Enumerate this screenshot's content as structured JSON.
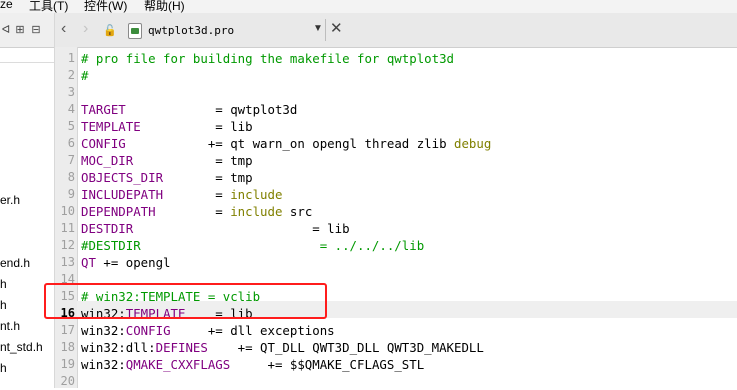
{
  "menubar": {
    "items": [
      "ze",
      "工具(T)",
      "控件(W)",
      "帮助(H)"
    ]
  },
  "left_panel": {
    "files": [
      "er.h",
      "end.h",
      "h",
      "h",
      "nt.h",
      "nt_std.h",
      "h"
    ]
  },
  "tab": {
    "title": "qwtplot3d.pro",
    "back_icon": "‹",
    "forward_icon": "›",
    "lock_icon": "🔓",
    "dropdown_icon": "▼",
    "close_icon": "✕"
  },
  "editor": {
    "current_line": 16,
    "highlighted_lines": [
      15,
      16
    ],
    "lines": [
      {
        "n": 1,
        "parts": [
          {
            "t": "# pro file for building the makefile for qwtplot3d",
            "c": "comment"
          }
        ]
      },
      {
        "n": 2,
        "parts": [
          {
            "t": "#",
            "c": "comment"
          }
        ]
      },
      {
        "n": 3,
        "parts": []
      },
      {
        "n": 4,
        "parts": [
          {
            "t": "TARGET",
            "c": "var"
          },
          {
            "t": "            = qwtplot3d",
            "c": "plain"
          }
        ]
      },
      {
        "n": 5,
        "parts": [
          {
            "t": "TEMPLATE",
            "c": "var"
          },
          {
            "t": "          = lib",
            "c": "plain"
          }
        ]
      },
      {
        "n": 6,
        "parts": [
          {
            "t": "CONFIG",
            "c": "var"
          },
          {
            "t": "           += qt warn_on opengl thread zlib ",
            "c": "plain"
          },
          {
            "t": "debug",
            "c": "keyword"
          }
        ]
      },
      {
        "n": 7,
        "parts": [
          {
            "t": "MOC_DIR",
            "c": "var"
          },
          {
            "t": "           = tmp",
            "c": "plain"
          }
        ]
      },
      {
        "n": 8,
        "parts": [
          {
            "t": "OBJECTS_DIR",
            "c": "var"
          },
          {
            "t": "       = tmp",
            "c": "plain"
          }
        ]
      },
      {
        "n": 9,
        "parts": [
          {
            "t": "INCLUDEPATH",
            "c": "var"
          },
          {
            "t": "       = ",
            "c": "plain"
          },
          {
            "t": "include",
            "c": "keyword"
          }
        ]
      },
      {
        "n": 10,
        "parts": [
          {
            "t": "DEPENDPATH",
            "c": "var"
          },
          {
            "t": "        = ",
            "c": "plain"
          },
          {
            "t": "include",
            "c": "keyword"
          },
          {
            "t": " src",
            "c": "plain"
          }
        ]
      },
      {
        "n": 11,
        "parts": [
          {
            "t": "DESTDIR",
            "c": "var"
          },
          {
            "t": "                        = lib",
            "c": "plain"
          }
        ]
      },
      {
        "n": 12,
        "parts": [
          {
            "t": "#DESTDIR                        = ../../../lib",
            "c": "comment"
          }
        ]
      },
      {
        "n": 13,
        "parts": [
          {
            "t": "QT",
            "c": "var"
          },
          {
            "t": " += opengl",
            "c": "plain"
          }
        ]
      },
      {
        "n": 14,
        "parts": []
      },
      {
        "n": 15,
        "parts": [
          {
            "t": "# win32:TEMPLATE = vclib",
            "c": "comment"
          }
        ]
      },
      {
        "n": 16,
        "parts": [
          {
            "t": "win32:",
            "c": "plain"
          },
          {
            "t": "TEMPLATE",
            "c": "var"
          },
          {
            "t": "    = lib",
            "c": "plain"
          }
        ]
      },
      {
        "n": 17,
        "parts": [
          {
            "t": "win32:",
            "c": "plain"
          },
          {
            "t": "CONFIG",
            "c": "var"
          },
          {
            "t": "     += dll exceptions",
            "c": "plain"
          }
        ]
      },
      {
        "n": 18,
        "parts": [
          {
            "t": "win32:dll:",
            "c": "plain"
          },
          {
            "t": "DEFINES",
            "c": "var"
          },
          {
            "t": "    += QT_DLL QWT3D_DLL QWT3D_MAKEDLL",
            "c": "plain"
          }
        ]
      },
      {
        "n": 19,
        "parts": [
          {
            "t": "win32:",
            "c": "plain"
          },
          {
            "t": "QMAKE_CXXFLAGS",
            "c": "var"
          },
          {
            "t": "     += $$QMAKE_CFLAGS_STL",
            "c": "plain"
          }
        ]
      },
      {
        "n": 20,
        "parts": []
      }
    ]
  },
  "colors": {
    "comment": "#009900",
    "variable": "#800080",
    "keyword": "#808000",
    "highlight_box": "#ff1c1c"
  }
}
